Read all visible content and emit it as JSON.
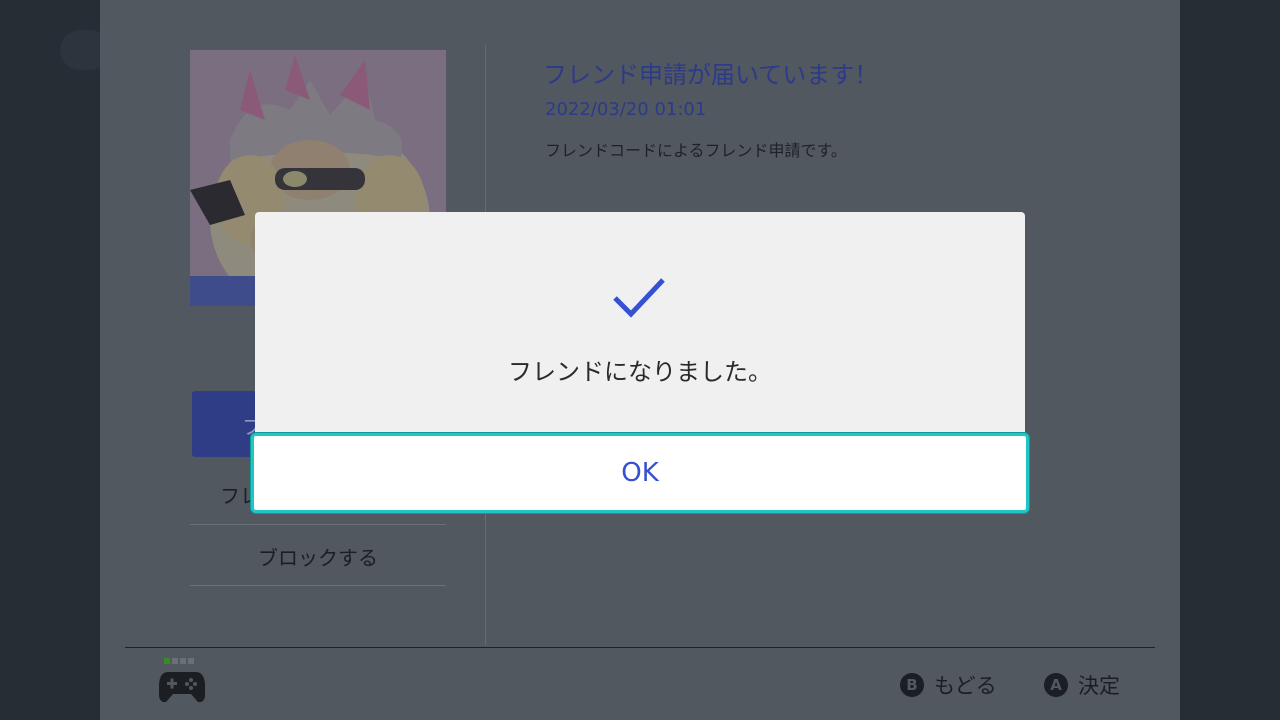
{
  "request": {
    "title": "フレンド申請が届いています！",
    "date": "2022/03/20 01:01",
    "description": "フレンドコードによるフレンド申請です。"
  },
  "menu": {
    "accept_label_partial": "フ",
    "option_partial": "フレ",
    "block_label": "ブロックする"
  },
  "dialog": {
    "message": "フレンドになりました。",
    "ok_label": "OK"
  },
  "footer": {
    "back_key": "B",
    "back_label": "もどる",
    "confirm_key": "A",
    "confirm_label": "決定",
    "player_dots": [
      true,
      false,
      false,
      false
    ]
  },
  "colors": {
    "accent": "#3550d2",
    "focus_ring": "#1fc6c6",
    "title_blue": "#2c3a8a"
  },
  "icons": {
    "check": "checkmark-icon",
    "controller": "gamepad-icon"
  }
}
